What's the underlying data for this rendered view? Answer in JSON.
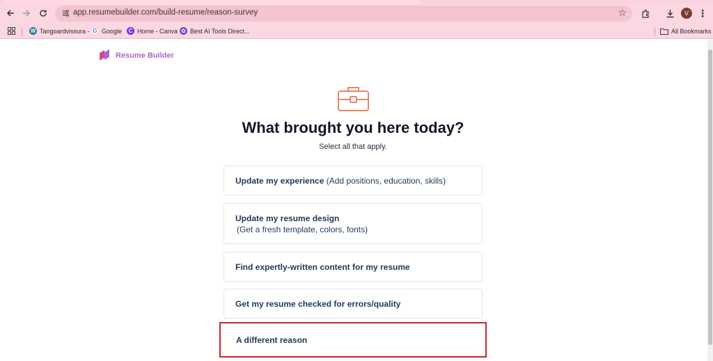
{
  "browser": {
    "url": "app.resumebuilder.com/build-resume/reason-survey",
    "profile_initial": "V",
    "bookmarks": [
      {
        "label": "Tangoardvissura -",
        "icon": "wordpress-icon",
        "color": "#21759b"
      },
      {
        "label": "Google",
        "icon": "google-icon",
        "color": "#4285f4"
      },
      {
        "label": "Home - Canva",
        "icon": "canva-icon",
        "color": "#7d2ae8"
      },
      {
        "label": "Best AI Tools Direct...",
        "icon": "gear-flower-icon",
        "color": "#6d4ad6"
      }
    ],
    "all_bookmarks_label": "All Bookmarks"
  },
  "brand": {
    "name": "Resume Builder",
    "color": "#b066c8"
  },
  "survey": {
    "title": "What brought you here today?",
    "subtitle": "Select all that apply.",
    "options": [
      {
        "strong": "Update my experience",
        "light": " (Add positions, education, skills)"
      },
      {
        "strong": "Update my resume design",
        "light": "(Get a fresh template, colors, fonts)"
      },
      {
        "strong": "Find expertly-written content for my resume",
        "light": ""
      },
      {
        "strong": "Get my resume checked for errors/quality",
        "light": ""
      },
      {
        "strong": "A different reason",
        "light": ""
      }
    ]
  },
  "colors": {
    "chrome_bg": "#fbd7e1",
    "highlight_border": "#c8242d",
    "icon_accent": "#e8866a",
    "option_text": "#1d3a5a"
  }
}
